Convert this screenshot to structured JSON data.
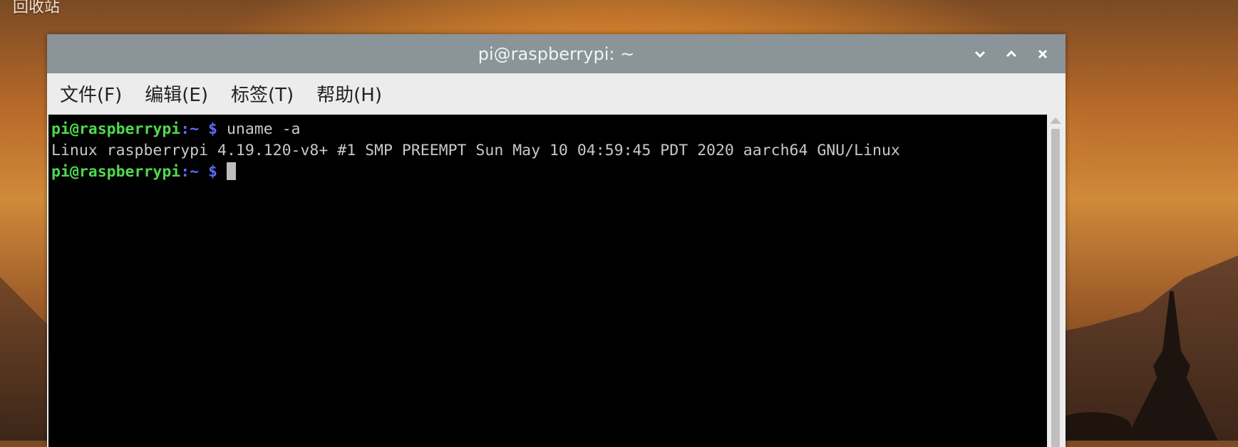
{
  "desktop": {
    "icon_label": "回收站"
  },
  "window": {
    "title": "pi@raspberrypi: ~",
    "controls": {
      "minimize": "minimize",
      "maximize": "maximize",
      "close": "close"
    }
  },
  "menu": {
    "items": [
      "文件(F)",
      "编辑(E)",
      "标签(T)",
      "帮助(H)"
    ]
  },
  "terminal": {
    "lines": [
      {
        "user": "pi@raspberrypi",
        "path": ":~ $",
        "cmd": " uname -a"
      },
      {
        "output": "Linux raspberrypi 4.19.120-v8+ #1 SMP PREEMPT Sun May 10 04:59:45 PDT 2020 aarch64 GNU/Linux"
      },
      {
        "user": "pi@raspberrypi",
        "path": ":~ $",
        "cmd": " "
      }
    ]
  },
  "colors": {
    "prompt_user": "#4fd94f",
    "prompt_path": "#5a6cf0",
    "titlebar": "#8a9499"
  }
}
